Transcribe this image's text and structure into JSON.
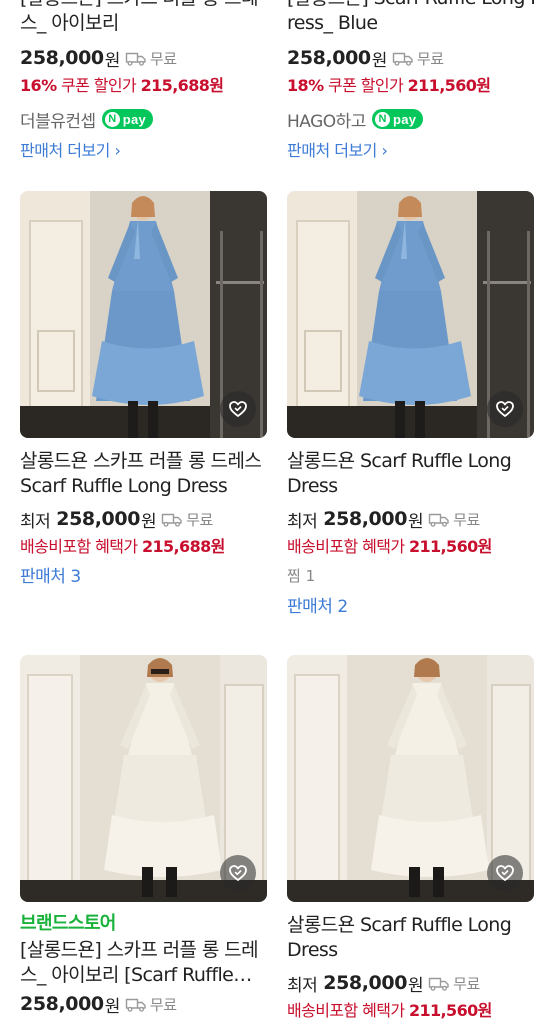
{
  "top_row": [
    {
      "title_line1": "[살롱드욘] 스카프 러플 롱 드레",
      "title_line2": "스_ 아이보리",
      "price": "258,000",
      "won": "원",
      "shipping": "무료",
      "discount_pct": "16%",
      "discount_label": "쿠폰 할인가",
      "discount_price": "215,688원",
      "mall": "더블유컨셉",
      "npay_label": "pay",
      "more_label": "판매처 더보기",
      "more_icon": "chevron-right-icon"
    },
    {
      "title_line1": "[살롱드욘] Scarf Ruffle Long D",
      "title_line2": "ress_ Blue",
      "price": "258,000",
      "won": "원",
      "shipping": "무료",
      "discount_pct": "18%",
      "discount_label": "쿠폰 할인가",
      "discount_price": "211,560원",
      "mall": "HAGO하고",
      "npay_label": "pay",
      "more_label": "판매처 더보기",
      "more_icon": "chevron-right-icon"
    }
  ],
  "middle_row": [
    {
      "image_color": "#6f9ccc",
      "title": "살롱드욘 스카프 러플 롱 드레스 Scarf Ruffle Long Dress",
      "lowest_label": "최저",
      "price": "258,000",
      "won": "원",
      "shipping": "무료",
      "benefit_label": "배송비포함 혜택가",
      "benefit_price": "215,688원",
      "sellers": "판매처 3"
    },
    {
      "image_color": "#6f9ccc",
      "title": "살롱드욘 Scarf Ruffle Long Dress",
      "lowest_label": "최저",
      "price": "258,000",
      "won": "원",
      "shipping": "무료",
      "benefit_label": "배송비포함 혜택가",
      "benefit_price": "211,560원",
      "zzim": "찜 1",
      "sellers": "판매처 2"
    }
  ],
  "bottom_row": [
    {
      "image_color": "#ece6d8",
      "brand_store": "브랜드스토어",
      "title": "[살롱드욘] 스카프 러플 롱 드레스_ 아이보리 [Scarf Ruffle Long Dress]",
      "price": "258,000",
      "won": "원",
      "shipping": "무료"
    },
    {
      "image_color": "#ece6d8",
      "title": "살롱드욘 Scarf Ruffle Long Dress",
      "lowest_label": "최저",
      "price": "258,000",
      "won": "원",
      "shipping": "무료",
      "benefit_label": "배송비포함 혜택가",
      "benefit_price": "211,560원"
    }
  ],
  "colors": {
    "accent_red": "#c8102e",
    "link_blue": "#3d7bd6",
    "naver_green": "#03c75a",
    "brand_green": "#19b23b"
  },
  "icons": {
    "heart": "heart-icon",
    "truck": "truck-icon"
  }
}
